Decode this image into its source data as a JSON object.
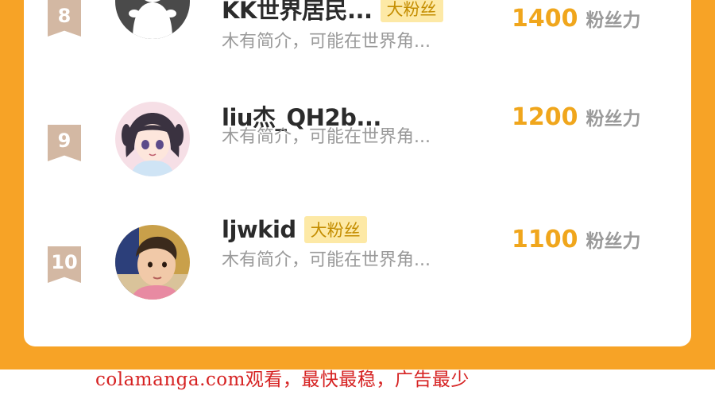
{
  "colors": {
    "background_orange": "#f7a326",
    "rank_badge": "#d3b8a3",
    "fan_badge_bg": "#fde9a6",
    "fan_badge_text": "#c48d00",
    "score": "#f0a61c",
    "watermark": "#d62222"
  },
  "leaderboard": {
    "rows": [
      {
        "rank": "8",
        "name": "KK世界居民...",
        "badge": "大粉丝",
        "intro": "木有简介，可能在世界角...",
        "score": "1400",
        "score_unit": "粉丝力",
        "avatar_icon": "default-user-avatar-icon"
      },
      {
        "rank": "9",
        "name": "liu杰_QH2b...",
        "badge": "",
        "intro": "木有简介，可能在世界角...",
        "score": "1200",
        "score_unit": "粉丝力",
        "avatar_icon": "anime-girl-avatar-icon"
      },
      {
        "rank": "10",
        "name": "ljwkid",
        "badge": "大粉丝",
        "intro": "木有简介，可能在世界角...",
        "score": "1100",
        "score_unit": "粉丝力",
        "avatar_icon": "child-photo-avatar-icon"
      }
    ]
  },
  "watermark": "colamanga.com观看，最快最稳，广告最少"
}
